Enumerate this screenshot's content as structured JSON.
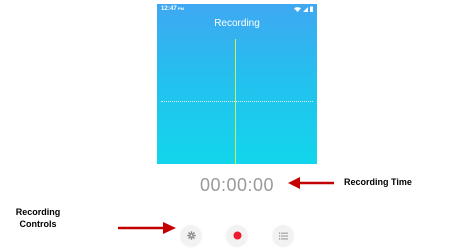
{
  "status_bar": {
    "time": "12:47",
    "ampm": "PM",
    "wifi_icon": "wifi-icon",
    "signal_icon": "signal-icon",
    "battery_icon": "battery-icon"
  },
  "screen": {
    "title": "Recording"
  },
  "timer": {
    "value": "00:00:00"
  },
  "controls": {
    "settings_icon": "gear-icon",
    "record_icon": "record-icon",
    "list_icon": "list-icon"
  },
  "annotations": {
    "recording_time": "Recording Time",
    "recording_controls_line1": "Recording",
    "recording_controls_line2": "Controls"
  },
  "colors": {
    "gradient_top": "#3fa8f2",
    "gradient_bottom": "#12d6ec",
    "playhead": "#c7ef54",
    "record_red": "#ee1b2e",
    "arrow_red": "#c40000",
    "timer_gray": "#9a9a9a"
  }
}
